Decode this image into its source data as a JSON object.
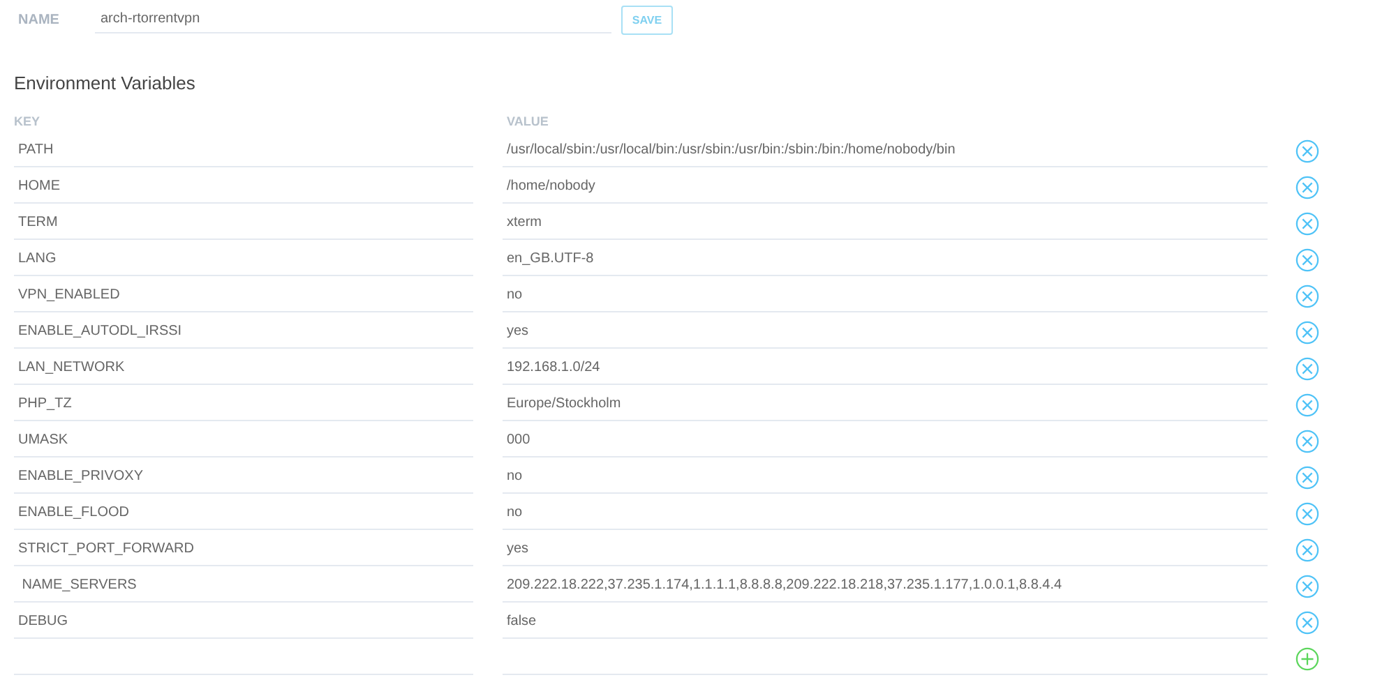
{
  "name_field": {
    "label": "NAME",
    "value": "arch-rtorrentvpn"
  },
  "save_button": "SAVE",
  "section_title": "Environment Variables",
  "columns": [
    "KEY",
    "VALUE"
  ],
  "variables": [
    {
      "key": "PATH",
      "value": "/usr/local/sbin:/usr/local/bin:/usr/sbin:/usr/bin:/sbin:/bin:/home/nobody/bin"
    },
    {
      "key": "HOME",
      "value": "/home/nobody"
    },
    {
      "key": "TERM",
      "value": "xterm"
    },
    {
      "key": "LANG",
      "value": "en_GB.UTF-8"
    },
    {
      "key": "VPN_ENABLED",
      "value": "no"
    },
    {
      "key": "ENABLE_AUTODL_IRSSI",
      "value": "yes"
    },
    {
      "key": "LAN_NETWORK",
      "value": "192.168.1.0/24"
    },
    {
      "key": "PHP_TZ",
      "value": "Europe/Stockholm"
    },
    {
      "key": "UMASK",
      "value": "000"
    },
    {
      "key": "ENABLE_PRIVOXY",
      "value": "no"
    },
    {
      "key": "ENABLE_FLOOD",
      "value": "no"
    },
    {
      "key": "STRICT_PORT_FORWARD",
      "value": "yes"
    },
    {
      "key": " NAME_SERVERS",
      "value": "209.222.18.222,37.235.1.174,1.1.1.1,8.8.8.8,209.222.18.218,37.235.1.177,1.0.0.1,8.8.4.4"
    },
    {
      "key": "DEBUG",
      "value": "false"
    }
  ]
}
